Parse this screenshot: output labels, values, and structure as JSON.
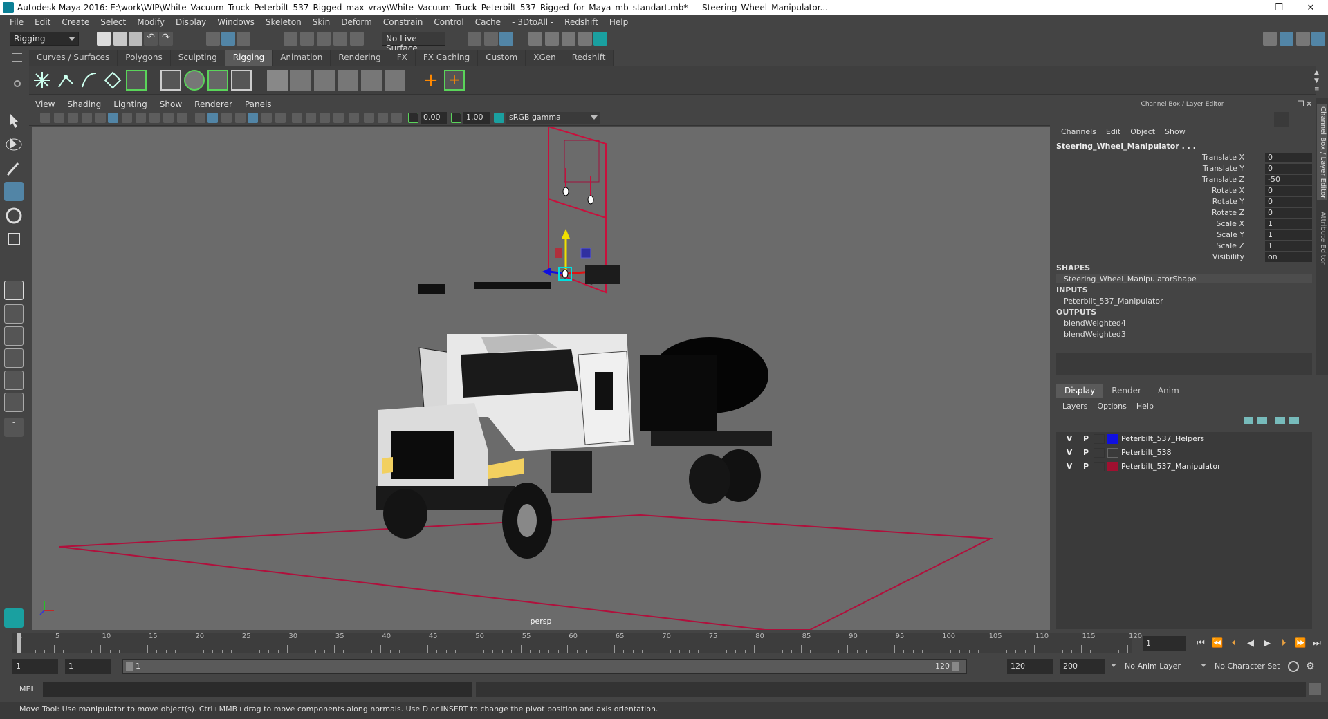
{
  "window": {
    "title": "Autodesk Maya 2016: E:\\work\\WIP\\White_Vacuum_Truck_Peterbilt_537_Rigged_max_vray\\White_Vacuum_Truck_Peterbilt_537_Rigged_for_Maya_mb_standart.mb*   ---   Steering_Wheel_Manipulator...",
    "minimize": "—",
    "maximize": "❐",
    "close": "✕"
  },
  "menus": [
    "File",
    "Edit",
    "Create",
    "Select",
    "Modify",
    "Display",
    "Windows",
    "Skeleton",
    "Skin",
    "Deform",
    "Constrain",
    "Control",
    "Cache",
    "- 3DtoAll -",
    "Redshift",
    "Help"
  ],
  "statusline": {
    "menuset": "Rigging",
    "live_surface": "No Live Surface"
  },
  "shelf": {
    "tabs": [
      "Curves / Surfaces",
      "Polygons",
      "Sculpting",
      "Rigging",
      "Animation",
      "Rendering",
      "FX",
      "FX Caching",
      "Custom",
      "XGen",
      "Redshift"
    ],
    "active_tab": "Rigging"
  },
  "viewport": {
    "menus": [
      "View",
      "Shading",
      "Lighting",
      "Show",
      "Renderer",
      "Panels"
    ],
    "exposure": "0.00",
    "gamma": "1.00",
    "color_space": "sRGB gamma",
    "camera_label": "persp"
  },
  "channel_box": {
    "header": "Channel Box / Layer Editor",
    "menus": [
      "Channels",
      "Edit",
      "Object",
      "Show"
    ],
    "object_name": "Steering_Wheel_Manipulator . . .",
    "channels": [
      {
        "name": "Translate X",
        "value": "0"
      },
      {
        "name": "Translate Y",
        "value": "0"
      },
      {
        "name": "Translate Z",
        "value": "-50"
      },
      {
        "name": "Rotate X",
        "value": "0"
      },
      {
        "name": "Rotate Y",
        "value": "0"
      },
      {
        "name": "Rotate Z",
        "value": "0"
      },
      {
        "name": "Scale X",
        "value": "1"
      },
      {
        "name": "Scale Y",
        "value": "1"
      },
      {
        "name": "Scale Z",
        "value": "1"
      },
      {
        "name": "Visibility",
        "value": "on"
      }
    ],
    "shapes_label": "SHAPES",
    "shapes": [
      "Steering_Wheel_ManipulatorShape"
    ],
    "inputs_label": "INPUTS",
    "inputs": [
      "Peterbilt_537_Manipulator"
    ],
    "outputs_label": "OUTPUTS",
    "outputs": [
      "blendWeighted4",
      "blendWeighted3"
    ]
  },
  "layer_editor": {
    "tabs": [
      "Display",
      "Render",
      "Anim"
    ],
    "active_tab": "Display",
    "menus": [
      "Layers",
      "Options",
      "Help"
    ],
    "layers": [
      {
        "v": "V",
        "p": "P",
        "name": "Peterbilt_537_Helpers",
        "color": "#1010e0"
      },
      {
        "v": "V",
        "p": "P",
        "name": "Peterbilt_538",
        "color": "#3a3a3a"
      },
      {
        "v": "V",
        "p": "P",
        "name": "Peterbilt_537_Manipulator",
        "color": "#a01030"
      }
    ]
  },
  "vertical_tabs": [
    "Channel Box / Layer Editor",
    "Attribute Editor"
  ],
  "timeline": {
    "ticks": [
      "1",
      "5",
      "10",
      "15",
      "20",
      "25",
      "30",
      "35",
      "40",
      "45",
      "50",
      "55",
      "60",
      "65",
      "70",
      "75",
      "80",
      "85",
      "90",
      "95",
      "100",
      "105",
      "110",
      "115",
      "120"
    ],
    "current_frame": "1"
  },
  "range": {
    "start": "1",
    "inner_start": "1",
    "slider_start": "1",
    "slider_end": "120",
    "inner_end": "120",
    "end": "200",
    "anim_layer": "No Anim Layer",
    "char_set": "No Character Set"
  },
  "command": {
    "label": "MEL"
  },
  "help_line": "Move Tool: Use manipulator to move object(s). Ctrl+MMB+drag to move components along normals. Use D or INSERT to change the pivot position and axis orientation.",
  "colors": {
    "accent": "#5285a6",
    "ground_grid": "#b0103c",
    "manipulator": "#c8103c"
  }
}
